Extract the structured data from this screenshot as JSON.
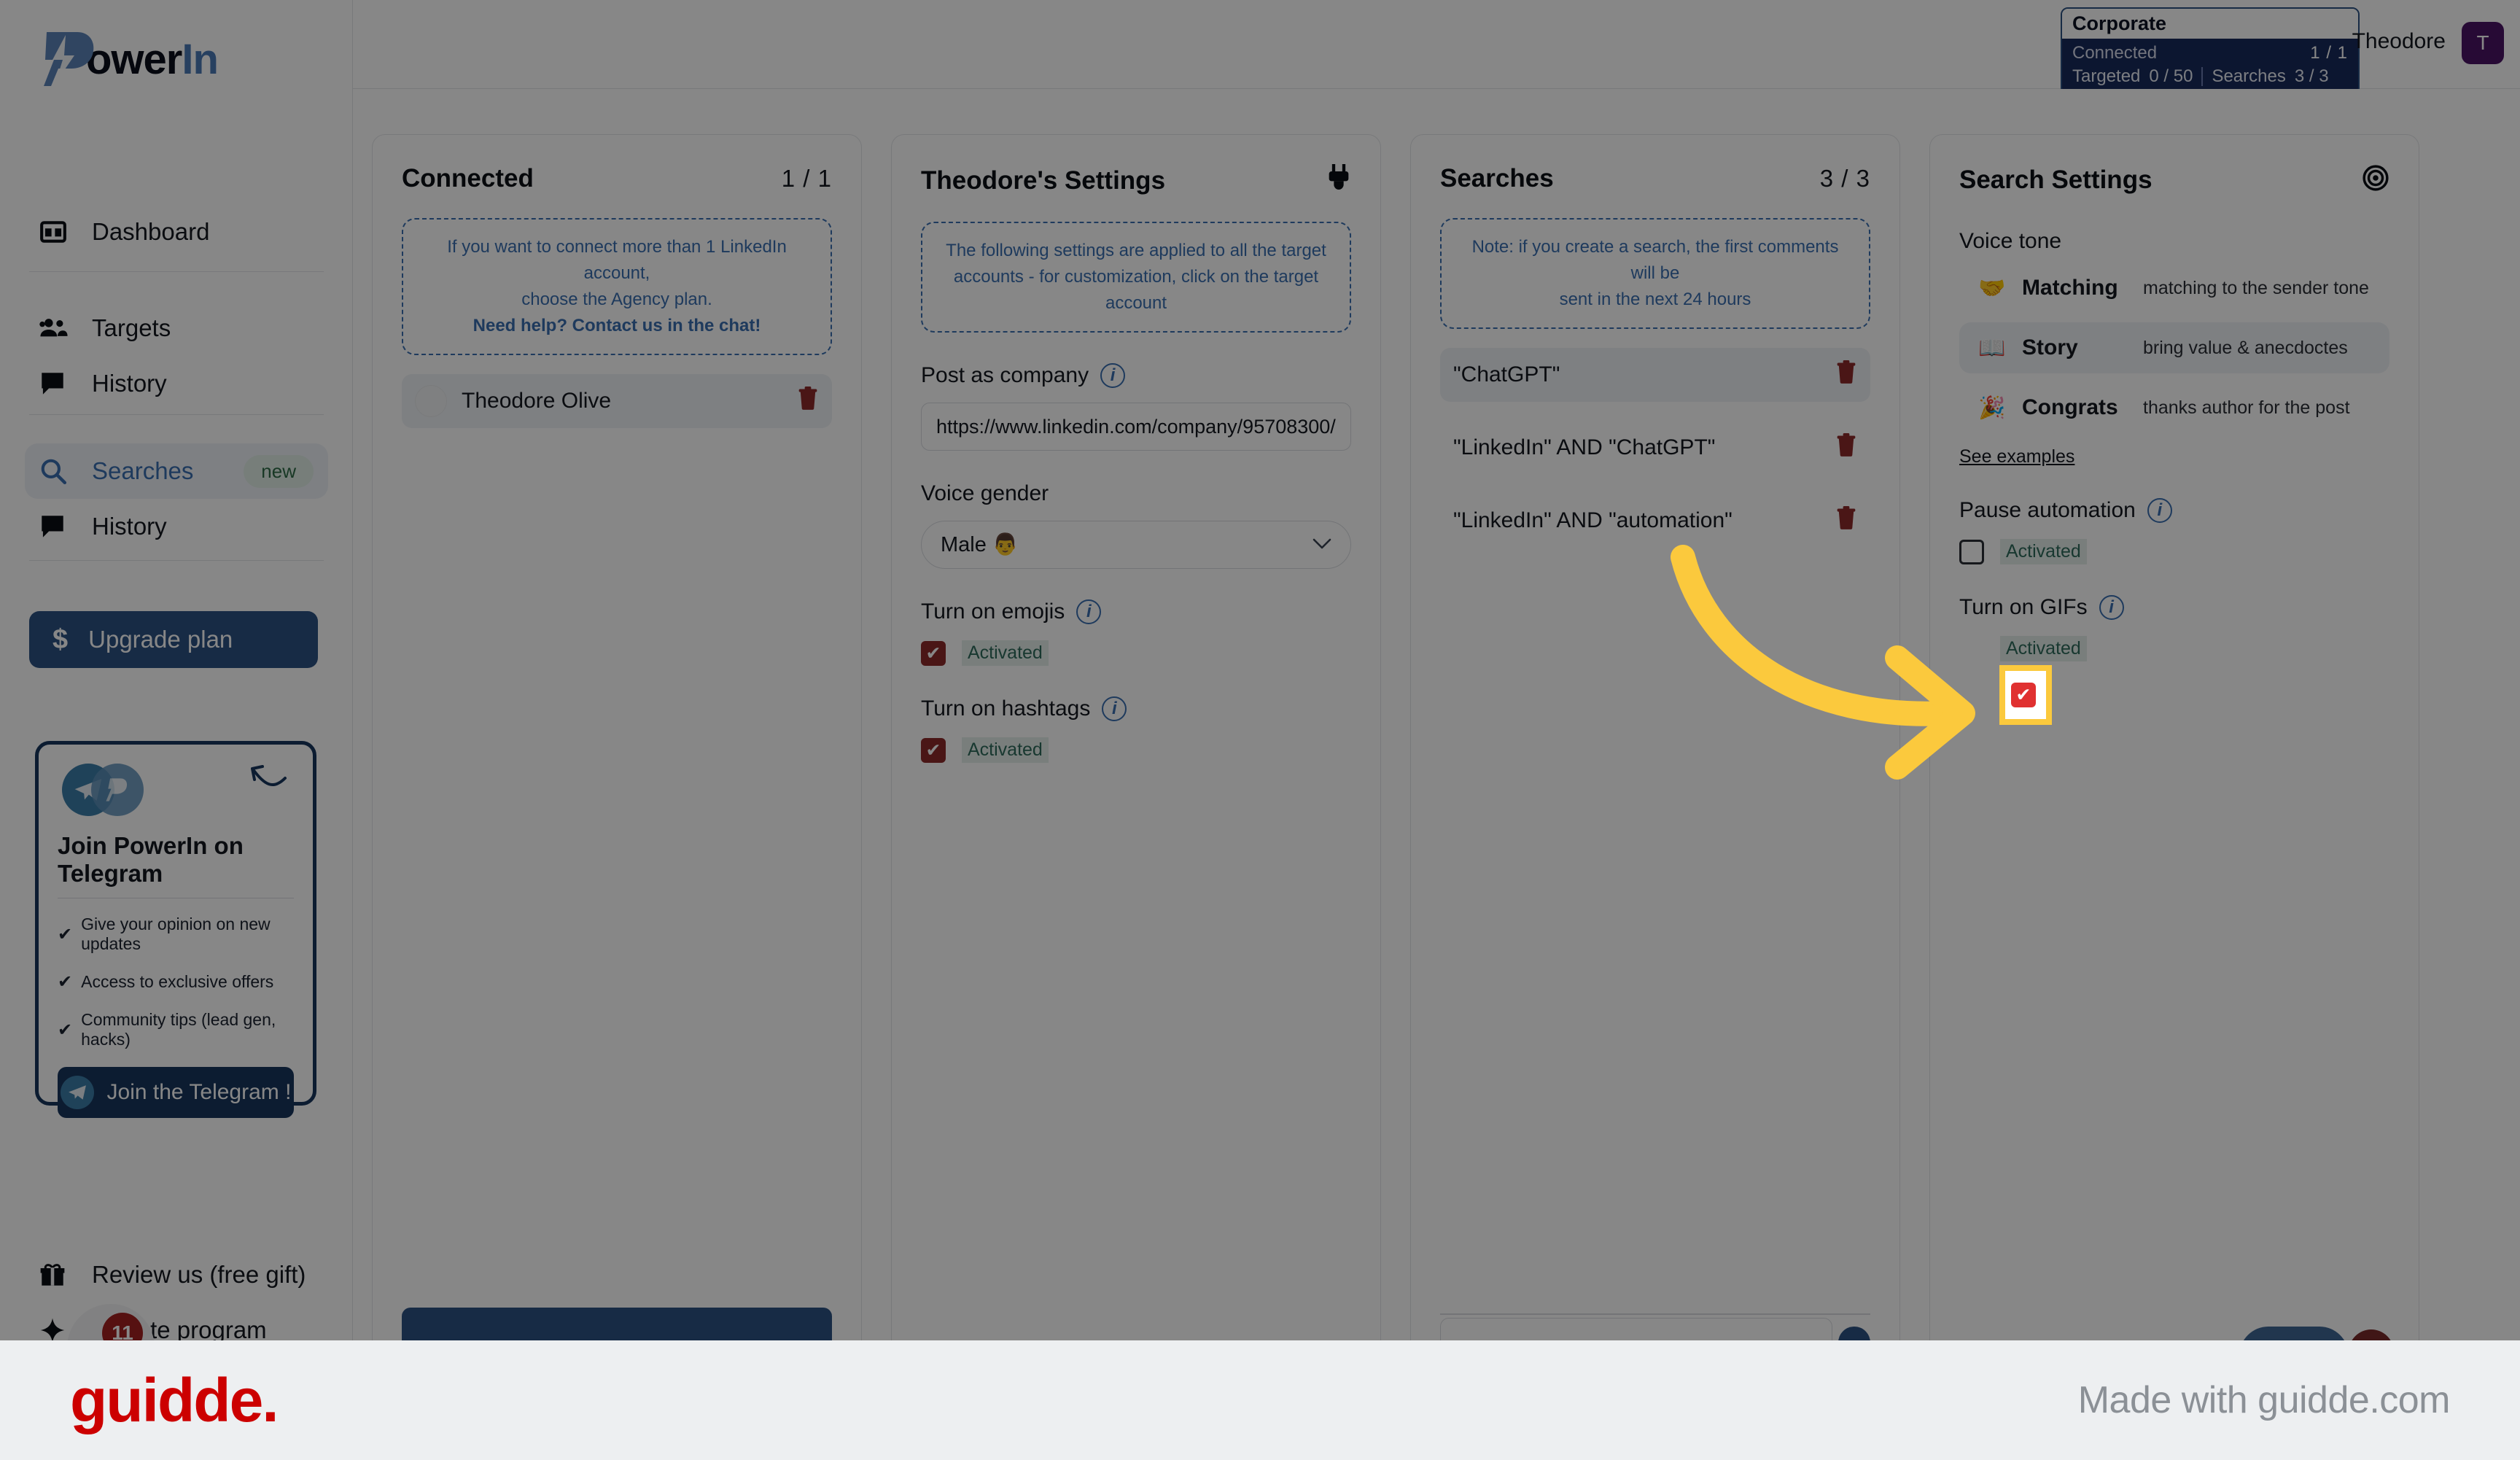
{
  "brand": {
    "name_power": "P",
    "name_ower": "ower",
    "name_in": "In",
    "accent": "#4a7ab5"
  },
  "sidebar": {
    "nav_top": [
      {
        "label": "Dashboard",
        "icon": "dashboard-icon"
      }
    ],
    "nav_targets": [
      {
        "label": "Targets",
        "icon": "people-icon"
      },
      {
        "label": "History",
        "icon": "chat-icon"
      }
    ],
    "nav_searches": [
      {
        "label": "Searches",
        "icon": "search-icon",
        "badge": "new",
        "active": true
      },
      {
        "label": "History",
        "icon": "chat-icon"
      }
    ],
    "upgrade": {
      "label": "Upgrade plan",
      "icon": "dollar-icon"
    },
    "telegram_card": {
      "title": "Join PowerIn on Telegram",
      "bullets": [
        "Give your opinion on new updates",
        "Access to exclusive offers",
        "Community tips (lead gen, hacks)"
      ],
      "check_glyph": "✔",
      "button_label": "Join the Telegram !"
    },
    "nav_bottom": [
      {
        "label": "Review us (free gift)",
        "icon": "gift-icon"
      },
      {
        "label": "Affiliate program",
        "icon": "star-icon",
        "badge": "11"
      }
    ]
  },
  "topbar": {
    "plan": {
      "name": "Corporate",
      "rows": [
        {
          "key": "Connected",
          "value": "1 / 1"
        }
      ],
      "row2": [
        {
          "key": "Targeted",
          "value": "0 / 50"
        },
        {
          "key": "Searches",
          "value": "3 / 3"
        }
      ]
    },
    "user_name": "Theodore",
    "user_initial": "T"
  },
  "columns": {
    "connected": {
      "title": "Connected",
      "count": "1 / 1",
      "callout_line1": "If you want to connect more than 1 LinkedIn account,",
      "callout_line2": "choose the Agency plan.",
      "callout_bold": "Need help? Contact us in the chat!",
      "accounts": [
        {
          "name": "Theodore Olive"
        }
      ],
      "trash_glyph": "🗑"
    },
    "settings": {
      "title": "Theodore's Settings",
      "header_icon": "plug-icon",
      "callout_line1": "The following settings are applied to all the target",
      "callout_line2": "accounts - for customization, click on the target account",
      "post_as_company_label": "Post as company",
      "post_as_company_value": "https://www.linkedin.com/company/95708300/",
      "voice_gender_label": "Voice gender",
      "voice_gender_value": "Male 👨",
      "emojis_label": "Turn on emojis",
      "emojis_state": "Activated",
      "hashtags_label": "Turn on hashtags",
      "hashtags_state": "Activated",
      "check_glyph": "✔",
      "chevron_glyph": "⌄",
      "info_glyph": "i"
    },
    "searches": {
      "title": "Searches",
      "count": "3 / 3",
      "callout_line1": "Note: if you create a search, the first comments will be",
      "callout_line2": "sent in the next 24 hours",
      "items": [
        {
          "query": "\"ChatGPT\"",
          "selected": true
        },
        {
          "query": "\"LinkedIn\" AND \"ChatGPT\"",
          "selected": false
        },
        {
          "query": "\"LinkedIn\" AND \"automation\"",
          "selected": false
        }
      ],
      "trash_glyph": "🗑"
    },
    "search_settings": {
      "title": "Search Settings",
      "header_icon": "target-icon",
      "voice_tone_label": "Voice tone",
      "tones": [
        {
          "emoji": "🤝",
          "name": "Matching",
          "desc": "matching to the sender tone",
          "selected": false
        },
        {
          "emoji": "📖",
          "name": "Story",
          "desc": "bring value & anecdoctes",
          "selected": true
        },
        {
          "emoji": "🎉",
          "name": "Congrats",
          "desc": "thanks author for the post",
          "selected": false
        }
      ],
      "see_examples": "See examples",
      "pause_label": "Pause automation",
      "pause_state": "Activated",
      "gifs_label": "Turn on GIFs",
      "gifs_state": "Activated",
      "check_glyph": "✔",
      "info_glyph": "i"
    }
  },
  "annotation": {
    "arrow_color": "#fbc93d",
    "highlight_color": "#fbc93d"
  },
  "banner": {
    "logo": "guidde.",
    "text": "Made with guidde.com",
    "logo_color": "#cc0000"
  }
}
